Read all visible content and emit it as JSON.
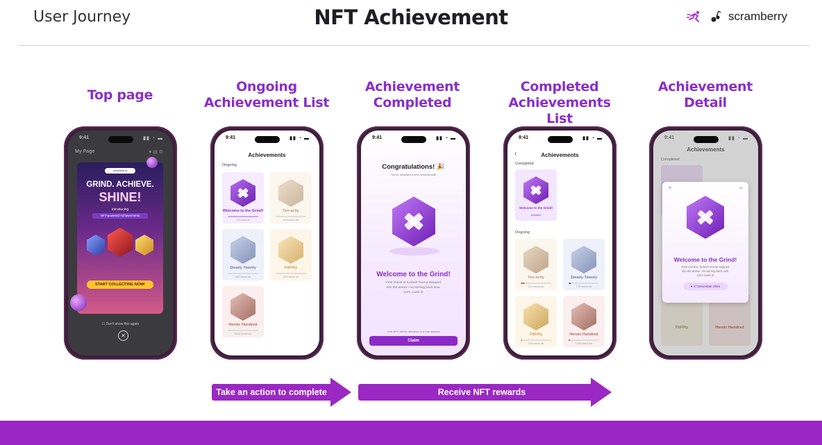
{
  "header": {
    "left_label": "User Journey",
    "title": "NFT Achievement",
    "brand_name": "scramberry",
    "brand_icons": [
      "runner-logo-icon",
      "berry-logo-icon"
    ]
  },
  "columns": [
    {
      "title_line1": "Top page",
      "title_line2": ""
    },
    {
      "title_line1": "Ongoing",
      "title_line2": "Achievement List"
    },
    {
      "title_line1": "Achievement",
      "title_line2": "Completed"
    },
    {
      "title_line1": "Completed",
      "title_line2": "Achievements List"
    },
    {
      "title_line1": "Achievement",
      "title_line2": "Detail"
    }
  ],
  "phones": {
    "status_time": "9:41",
    "top_page": {
      "page_label": "My Page",
      "promo_badge": "scramberry",
      "headline1": "GRIND. ACHIEVE.",
      "headline2": "SHINE!",
      "intro1": "Introducing",
      "intro2": "NFT-powered Achievements",
      "cta": "START COLLECTING NOW!",
      "dont_show": "Don't show this again",
      "close_glyph": "✕"
    },
    "ongoing_list": {
      "title": "Achievements",
      "section": "Ongoing",
      "cards": [
        {
          "name": "Welcome to the Grind!",
          "sub": "1/1 check-in"
        },
        {
          "name": "Ten-acity",
          "sub": "0/10 check-ins"
        },
        {
          "name": "Steady Twenty",
          "sub": "0/20 check-ins"
        },
        {
          "name": "FitFifty",
          "sub": "0/50 check-ins"
        },
        {
          "name": "Heroic Hundred",
          "sub": "0/100 check-ins"
        }
      ]
    },
    "completed": {
      "congrats": "Congratulations! 🎉",
      "congrats_sub": "You've unlocked a new achievement!",
      "name": "Welcome to the Grind!",
      "desc1": "First check-in locked! You've stepped",
      "desc2": "into the arena—no turning back now.",
      "desc3": "Let's crush it!",
      "nft_note": "Your NFT will be delivered in a few minutes",
      "claim": "Claim"
    },
    "completed_list": {
      "title": "Achievements",
      "back_glyph": "‹",
      "section_done": "Completed",
      "section_ongoing": "Ongoing",
      "done_card": {
        "name": "Welcome to the Grind!",
        "sub": "Unlocked"
      },
      "cards": [
        {
          "name": "Ten-acity",
          "sub": "1/10 check-ins"
        },
        {
          "name": "Steady Twenty",
          "sub": "1/20 check-ins"
        },
        {
          "name": "FitFifty",
          "sub": "1/50 check-ins"
        },
        {
          "name": "Heroic Hundred",
          "sub": "1/100 check-ins"
        }
      ]
    },
    "detail": {
      "title": "Achievements",
      "section": "Completed",
      "close_glyph": "✕",
      "share_glyph": "⋖",
      "name": "Welcome to the Grind!",
      "desc1": "First check-in locked! You've stepped",
      "desc2": "into the arena—no turning back now.",
      "desc3": "Let's crush it!",
      "date": "17 December 2024",
      "bg_cards": [
        "FitFifty",
        "Heroic Hundred"
      ]
    }
  },
  "arrows": [
    {
      "label": "Take an action to complete"
    },
    {
      "label": "Receive NFT rewards"
    }
  ],
  "colors": {
    "accent": "#9b25c4",
    "title_purple": "#8a2fc9",
    "phone_frame": "#3d1f3b"
  }
}
